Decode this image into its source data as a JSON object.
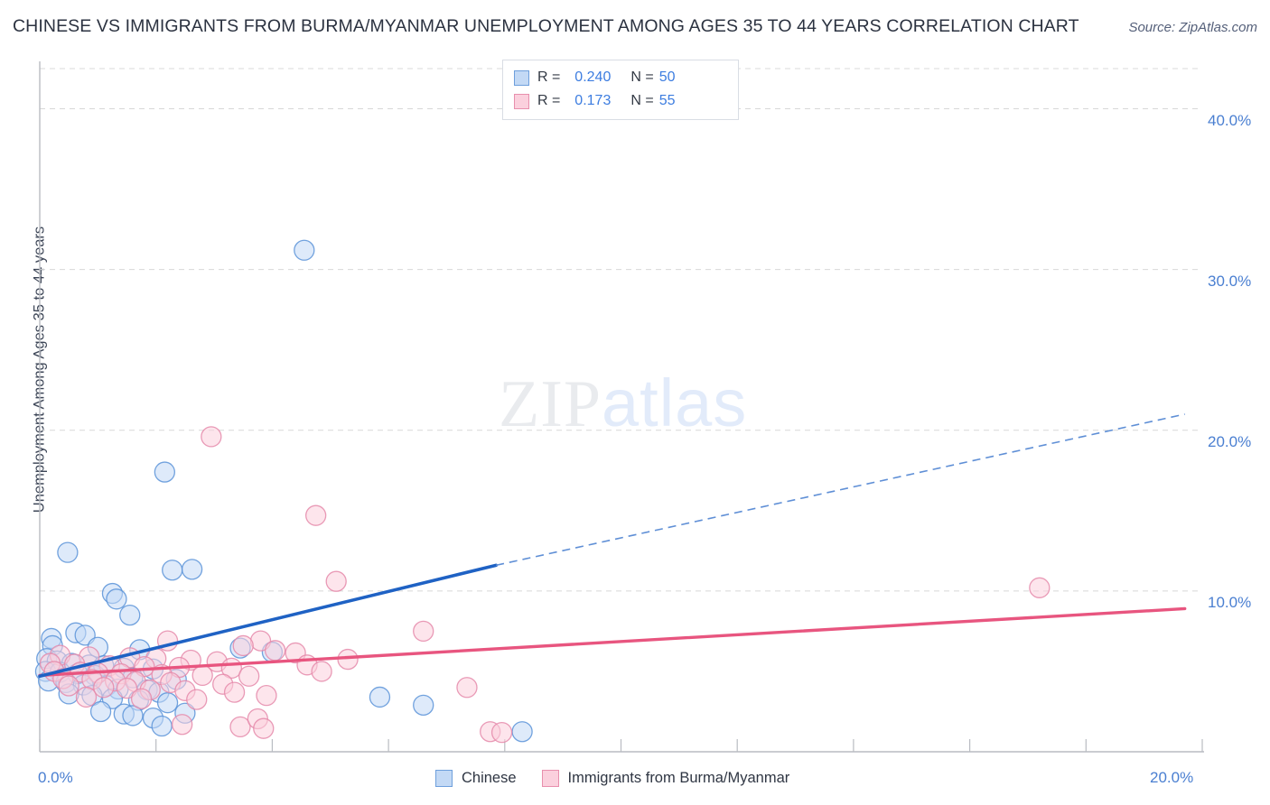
{
  "header": {
    "title": "CHINESE VS IMMIGRANTS FROM BURMA/MYANMAR UNEMPLOYMENT AMONG AGES 35 TO 44 YEARS CORRELATION CHART",
    "source": "Source: ZipAtlas.com"
  },
  "watermark": {
    "part1": "ZIP",
    "part2": "atlas"
  },
  "stats": {
    "rows": [
      {
        "r_label": "R =",
        "r_value": "0.240",
        "n_label": "N =",
        "n_value": "50",
        "color": "#c3d9f5"
      },
      {
        "r_label": "R =",
        "r_value": "0.173",
        "n_label": "N =",
        "n_value": "55",
        "color": "#fbd0dd"
      }
    ]
  },
  "legend": {
    "items": [
      {
        "label": "Chinese",
        "color": "#c3d9f5",
        "border": "#6e9fdc"
      },
      {
        "label": "Immigrants from Burma/Myanmar",
        "color": "#fbd0dd",
        "border": "#e88fad"
      }
    ]
  },
  "colors": {
    "blue_fill": "#c3d9f5",
    "blue_stroke": "#5b93d8",
    "pink_fill": "#fbd0dd",
    "pink_stroke": "#e58aaa",
    "blue_line": "#1f62c4",
    "pink_line": "#e8557f",
    "tick_text": "#4a7fd1",
    "grid": "#d8d8d8",
    "axis": "#b9bcc2"
  },
  "chart_data": {
    "type": "scatter",
    "title": "CHINESE VS IMMIGRANTS FROM BURMA/MYANMAR UNEMPLOYMENT AMONG AGES 35 TO 44 YEARS CORRELATION CHART",
    "xlabel": "",
    "ylabel": "Unemployment Among Ages 35 to 44 years",
    "xlim": [
      0,
      20
    ],
    "ylim": [
      0,
      42.5
    ],
    "grid": true,
    "legend_position": "bottom",
    "x_ticks": [
      0,
      20
    ],
    "x_tick_labels": [
      "0.0%",
      "20.0%"
    ],
    "y_ticks": [
      10,
      20,
      30,
      40
    ],
    "y_tick_labels": [
      "10.0%",
      "20.0%",
      "30.0%",
      "40.0%"
    ],
    "series": [
      {
        "name": "Chinese",
        "color": "#c3d9f5",
        "stroke": "#5b93d8",
        "r": 0.24,
        "n": 50,
        "trend": {
          "type": "linear",
          "x0": 0.0,
          "y0": 4.7,
          "x1": 7.85,
          "y1": 11.6,
          "dashed_to": {
            "x": 19.7,
            "y": 21.0
          }
        },
        "points": [
          [
            4.55,
            31.2
          ],
          [
            2.15,
            17.4
          ],
          [
            0.48,
            12.4
          ],
          [
            2.28,
            11.3
          ],
          [
            2.62,
            11.35
          ],
          [
            1.25,
            9.85
          ],
          [
            1.32,
            9.5
          ],
          [
            1.55,
            8.5
          ],
          [
            0.62,
            7.4
          ],
          [
            0.78,
            7.25
          ],
          [
            0.2,
            7.05
          ],
          [
            0.22,
            6.6
          ],
          [
            1.0,
            6.5
          ],
          [
            1.72,
            6.35
          ],
          [
            3.45,
            6.45
          ],
          [
            4.0,
            6.2
          ],
          [
            0.12,
            5.8
          ],
          [
            0.3,
            5.65
          ],
          [
            0.55,
            5.5
          ],
          [
            0.85,
            5.4
          ],
          [
            1.1,
            5.35
          ],
          [
            1.45,
            5.2
          ],
          [
            1.95,
            5.15
          ],
          [
            0.1,
            5.0
          ],
          [
            0.35,
            4.95
          ],
          [
            0.65,
            4.85
          ],
          [
            0.95,
            4.75
          ],
          [
            1.6,
            4.6
          ],
          [
            2.35,
            4.5
          ],
          [
            0.15,
            4.4
          ],
          [
            0.45,
            4.3
          ],
          [
            0.75,
            4.15
          ],
          [
            1.15,
            4.1
          ],
          [
            1.35,
            3.9
          ],
          [
            1.85,
            3.85
          ],
          [
            2.05,
            3.7
          ],
          [
            0.5,
            3.6
          ],
          [
            0.9,
            3.5
          ],
          [
            1.25,
            3.3
          ],
          [
            1.7,
            3.2
          ],
          [
            2.2,
            3.05
          ],
          [
            5.85,
            3.4
          ],
          [
            6.6,
            2.9
          ],
          [
            1.05,
            2.5
          ],
          [
            1.45,
            2.35
          ],
          [
            1.6,
            2.25
          ],
          [
            1.95,
            2.1
          ],
          [
            2.5,
            2.4
          ],
          [
            2.1,
            1.6
          ],
          [
            8.3,
            1.25
          ]
        ]
      },
      {
        "name": "Immigrants from Burma/Myanmar",
        "color": "#fbd0dd",
        "stroke": "#e58aaa",
        "r": 0.173,
        "n": 55,
        "trend": {
          "type": "linear",
          "x0": 0.0,
          "y0": 4.75,
          "x1": 19.7,
          "y1": 8.9
        },
        "points": [
          [
            2.95,
            19.6
          ],
          [
            4.75,
            14.7
          ],
          [
            17.2,
            10.2
          ],
          [
            5.1,
            10.6
          ],
          [
            6.6,
            7.5
          ],
          [
            3.8,
            6.9
          ],
          [
            2.2,
            6.9
          ],
          [
            3.5,
            6.6
          ],
          [
            4.05,
            6.3
          ],
          [
            4.4,
            6.15
          ],
          [
            0.35,
            6.0
          ],
          [
            0.85,
            5.9
          ],
          [
            1.55,
            5.85
          ],
          [
            2.0,
            5.8
          ],
          [
            2.6,
            5.7
          ],
          [
            3.05,
            5.6
          ],
          [
            5.3,
            5.75
          ],
          [
            0.18,
            5.5
          ],
          [
            0.6,
            5.45
          ],
          [
            1.2,
            5.35
          ],
          [
            1.8,
            5.3
          ],
          [
            2.4,
            5.25
          ],
          [
            3.3,
            5.2
          ],
          [
            4.6,
            5.4
          ],
          [
            0.25,
            5.0
          ],
          [
            0.7,
            4.95
          ],
          [
            1.0,
            4.9
          ],
          [
            1.4,
            4.85
          ],
          [
            2.1,
            4.8
          ],
          [
            2.8,
            4.75
          ],
          [
            3.6,
            4.7
          ],
          [
            4.85,
            5.0
          ],
          [
            0.4,
            4.55
          ],
          [
            0.9,
            4.5
          ],
          [
            1.3,
            4.4
          ],
          [
            1.65,
            4.35
          ],
          [
            2.25,
            4.3
          ],
          [
            3.15,
            4.2
          ],
          [
            0.5,
            4.1
          ],
          [
            1.1,
            4.0
          ],
          [
            1.5,
            3.95
          ],
          [
            1.9,
            3.85
          ],
          [
            2.5,
            3.8
          ],
          [
            3.35,
            3.7
          ],
          [
            3.9,
            3.5
          ],
          [
            0.8,
            3.4
          ],
          [
            1.75,
            3.3
          ],
          [
            2.7,
            3.25
          ],
          [
            7.35,
            4.0
          ],
          [
            2.45,
            1.7
          ],
          [
            3.45,
            1.55
          ],
          [
            3.75,
            2.05
          ],
          [
            3.85,
            1.45
          ],
          [
            7.75,
            1.25
          ],
          [
            7.95,
            1.2
          ]
        ]
      }
    ]
  }
}
